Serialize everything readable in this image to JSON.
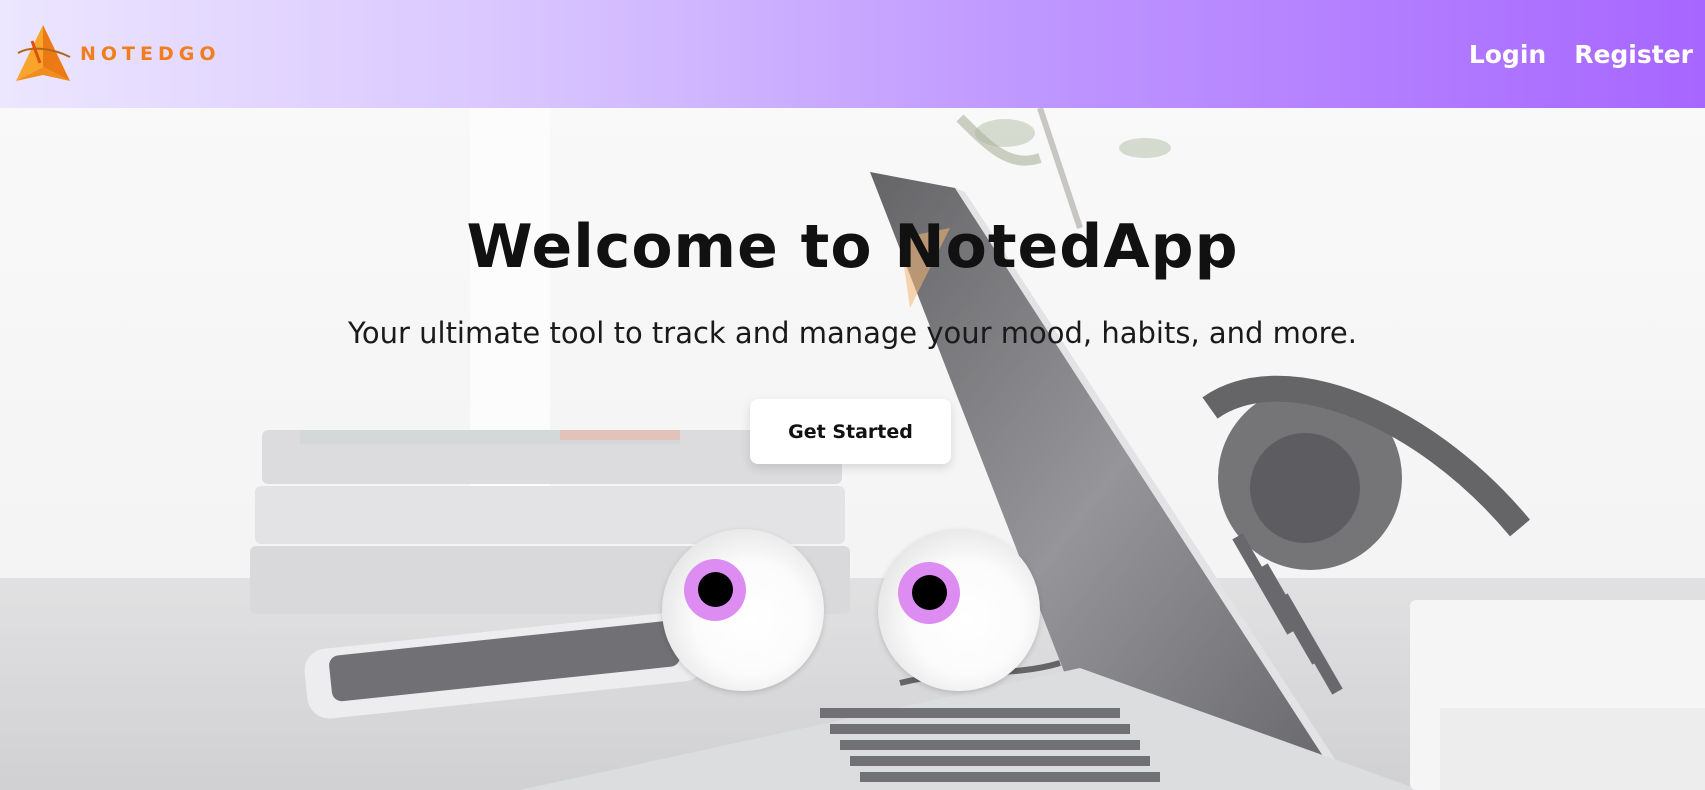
{
  "brand": {
    "name": "NOTEDGO",
    "color": "#f17d1e"
  },
  "nav": {
    "login_label": "Login",
    "register_label": "Register"
  },
  "hero": {
    "title": "Welcome to NotedApp",
    "subtitle": "Your ultimate tool to track and manage your mood, habits, and more.",
    "cta_label": "Get Started"
  },
  "colors": {
    "header_gradient_start": "#ece6ff",
    "header_gradient_end": "#a766ff",
    "iris": "#dd8cf2",
    "pupil": "#000000"
  },
  "icons": {
    "logo": "logo-icon",
    "eyes": "googly-eyes"
  }
}
